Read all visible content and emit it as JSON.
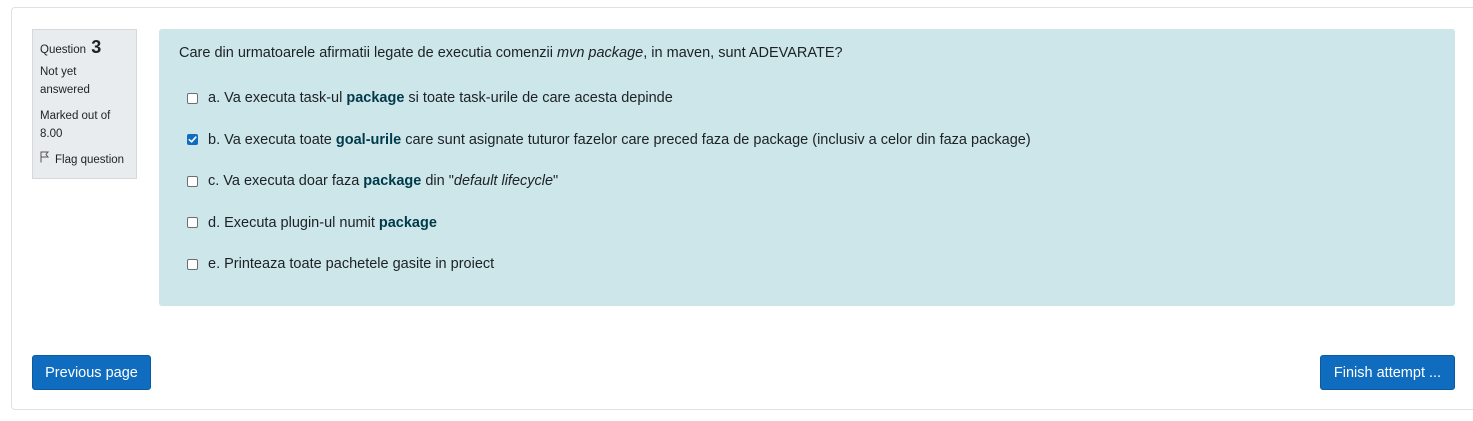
{
  "question_info": {
    "label": "Question",
    "number": "3",
    "state": "Not yet answered",
    "grade": "Marked out of 8.00",
    "flag_label": "Flag question"
  },
  "question": {
    "text_prefix": "Care din urmatoarele afirmatii legate de executia comenzii ",
    "text_em": "mvn package",
    "text_suffix": ", in maven, sunt ADEVARATE?"
  },
  "answers": [
    {
      "checked": false,
      "p1": "a. Va executa task-ul ",
      "b1": "package",
      "p2": " si toate task-urile de care acesta depinde",
      "em": "",
      "p3": ""
    },
    {
      "checked": true,
      "p1": "b. Va executa toate ",
      "b1": "goal-urile",
      "p2": " care sunt asignate tuturor fazelor care preced faza de package (inclusiv a celor din faza package)",
      "em": "",
      "p3": ""
    },
    {
      "checked": false,
      "p1": "c. Va executa doar faza ",
      "b1": "package",
      "p2": " din \"",
      "em": "default lifecycle",
      "p3": "\""
    },
    {
      "checked": false,
      "p1": "d. Executa plugin-ul numit ",
      "b1": "package",
      "p2": "",
      "em": "",
      "p3": ""
    },
    {
      "checked": false,
      "p1": "e. Printeaza toate pachetele gasite in proiect",
      "b1": "",
      "p2": "",
      "em": "",
      "p3": ""
    }
  ],
  "nav": {
    "prev_label": "Previous page",
    "finish_label": "Finish attempt ..."
  },
  "colors": {
    "accent": "#0f6cbf",
    "content_bg": "#cce6ea",
    "info_bg": "#e9ecef"
  }
}
